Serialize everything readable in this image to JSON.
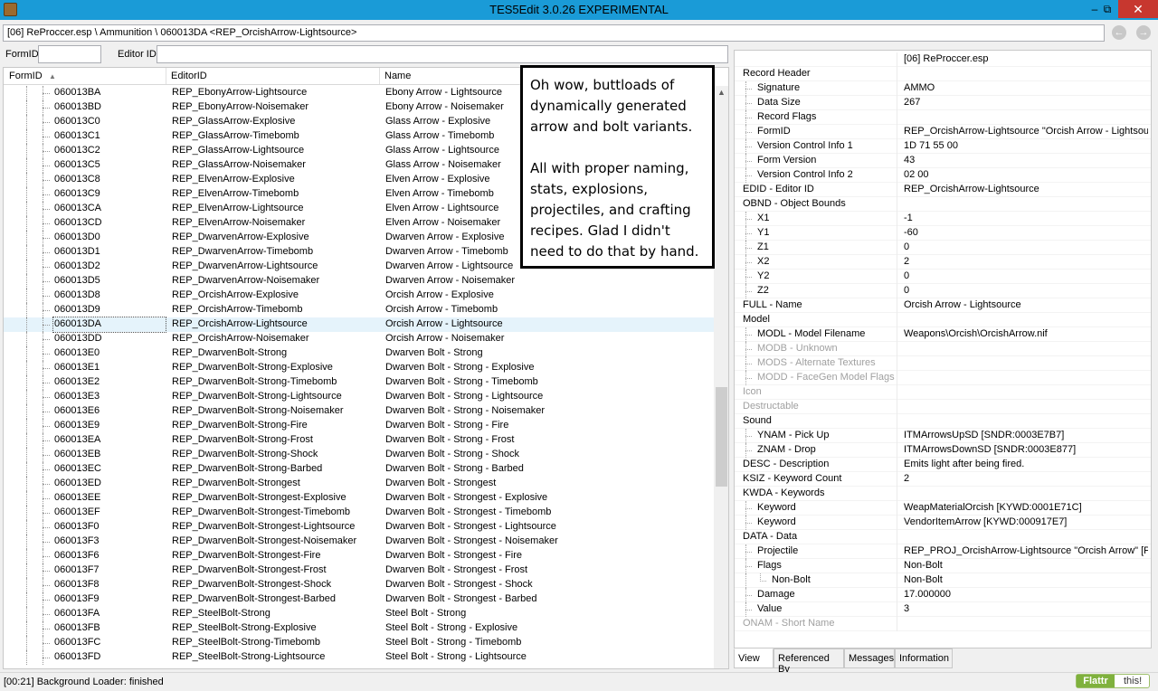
{
  "window": {
    "title": "TES5Edit 3.0.26 EXPERIMENTAL",
    "minimize": "–",
    "maximize": "⧉",
    "close": "✕"
  },
  "path": "[06] ReProccer.esp \\ Ammunition \\ 060013DA <REP_OrcishArrow-Lightsource>",
  "nav": {
    "back": "←",
    "forward": "→"
  },
  "filters": {
    "formid_label": "FormID",
    "editorid_label": "Editor ID",
    "formid_value": "",
    "editorid_value": ""
  },
  "list": {
    "headers": {
      "formid": "FormID",
      "sort_icon": "▲",
      "editorid": "EditorID",
      "name": "Name"
    },
    "selected_index": 16,
    "rows": [
      {
        "formid": "060013BA",
        "edid": "REP_EbonyArrow-Lightsource",
        "name": "Ebony Arrow - Lightsource"
      },
      {
        "formid": "060013BD",
        "edid": "REP_EbonyArrow-Noisemaker",
        "name": "Ebony Arrow - Noisemaker"
      },
      {
        "formid": "060013C0",
        "edid": "REP_GlassArrow-Explosive",
        "name": "Glass Arrow - Explosive"
      },
      {
        "formid": "060013C1",
        "edid": "REP_GlassArrow-Timebomb",
        "name": "Glass Arrow - Timebomb"
      },
      {
        "formid": "060013C2",
        "edid": "REP_GlassArrow-Lightsource",
        "name": "Glass Arrow - Lightsource"
      },
      {
        "formid": "060013C5",
        "edid": "REP_GlassArrow-Noisemaker",
        "name": "Glass Arrow - Noisemaker"
      },
      {
        "formid": "060013C8",
        "edid": "REP_ElvenArrow-Explosive",
        "name": "Elven Arrow - Explosive"
      },
      {
        "formid": "060013C9",
        "edid": "REP_ElvenArrow-Timebomb",
        "name": "Elven Arrow - Timebomb"
      },
      {
        "formid": "060013CA",
        "edid": "REP_ElvenArrow-Lightsource",
        "name": "Elven Arrow - Lightsource"
      },
      {
        "formid": "060013CD",
        "edid": "REP_ElvenArrow-Noisemaker",
        "name": "Elven Arrow - Noisemaker"
      },
      {
        "formid": "060013D0",
        "edid": "REP_DwarvenArrow-Explosive",
        "name": "Dwarven Arrow - Explosive"
      },
      {
        "formid": "060013D1",
        "edid": "REP_DwarvenArrow-Timebomb",
        "name": "Dwarven Arrow - Timebomb"
      },
      {
        "formid": "060013D2",
        "edid": "REP_DwarvenArrow-Lightsource",
        "name": "Dwarven Arrow - Lightsource"
      },
      {
        "formid": "060013D5",
        "edid": "REP_DwarvenArrow-Noisemaker",
        "name": "Dwarven Arrow - Noisemaker"
      },
      {
        "formid": "060013D8",
        "edid": "REP_OrcishArrow-Explosive",
        "name": "Orcish Arrow - Explosive"
      },
      {
        "formid": "060013D9",
        "edid": "REP_OrcishArrow-Timebomb",
        "name": "Orcish Arrow - Timebomb"
      },
      {
        "formid": "060013DA",
        "edid": "REP_OrcishArrow-Lightsource",
        "name": "Orcish Arrow - Lightsource"
      },
      {
        "formid": "060013DD",
        "edid": "REP_OrcishArrow-Noisemaker",
        "name": "Orcish Arrow - Noisemaker"
      },
      {
        "formid": "060013E0",
        "edid": "REP_DwarvenBolt-Strong",
        "name": "Dwarven Bolt - Strong"
      },
      {
        "formid": "060013E1",
        "edid": "REP_DwarvenBolt-Strong-Explosive",
        "name": "Dwarven Bolt - Strong - Explosive"
      },
      {
        "formid": "060013E2",
        "edid": "REP_DwarvenBolt-Strong-Timebomb",
        "name": "Dwarven Bolt - Strong - Timebomb"
      },
      {
        "formid": "060013E3",
        "edid": "REP_DwarvenBolt-Strong-Lightsource",
        "name": "Dwarven Bolt - Strong - Lightsource"
      },
      {
        "formid": "060013E6",
        "edid": "REP_DwarvenBolt-Strong-Noisemaker",
        "name": "Dwarven Bolt - Strong - Noisemaker"
      },
      {
        "formid": "060013E9",
        "edid": "REP_DwarvenBolt-Strong-Fire",
        "name": "Dwarven Bolt - Strong - Fire"
      },
      {
        "formid": "060013EA",
        "edid": "REP_DwarvenBolt-Strong-Frost",
        "name": "Dwarven Bolt - Strong - Frost"
      },
      {
        "formid": "060013EB",
        "edid": "REP_DwarvenBolt-Strong-Shock",
        "name": "Dwarven Bolt - Strong - Shock"
      },
      {
        "formid": "060013EC",
        "edid": "REP_DwarvenBolt-Strong-Barbed",
        "name": "Dwarven Bolt - Strong - Barbed"
      },
      {
        "formid": "060013ED",
        "edid": "REP_DwarvenBolt-Strongest",
        "name": "Dwarven Bolt - Strongest"
      },
      {
        "formid": "060013EE",
        "edid": "REP_DwarvenBolt-Strongest-Explosive",
        "name": "Dwarven Bolt - Strongest - Explosive"
      },
      {
        "formid": "060013EF",
        "edid": "REP_DwarvenBolt-Strongest-Timebomb",
        "name": "Dwarven Bolt - Strongest - Timebomb"
      },
      {
        "formid": "060013F0",
        "edid": "REP_DwarvenBolt-Strongest-Lightsource",
        "name": "Dwarven Bolt - Strongest - Lightsource"
      },
      {
        "formid": "060013F3",
        "edid": "REP_DwarvenBolt-Strongest-Noisemaker",
        "name": "Dwarven Bolt - Strongest - Noisemaker"
      },
      {
        "formid": "060013F6",
        "edid": "REP_DwarvenBolt-Strongest-Fire",
        "name": "Dwarven Bolt - Strongest - Fire"
      },
      {
        "formid": "060013F7",
        "edid": "REP_DwarvenBolt-Strongest-Frost",
        "name": "Dwarven Bolt - Strongest - Frost"
      },
      {
        "formid": "060013F8",
        "edid": "REP_DwarvenBolt-Strongest-Shock",
        "name": "Dwarven Bolt - Strongest - Shock"
      },
      {
        "formid": "060013F9",
        "edid": "REP_DwarvenBolt-Strongest-Barbed",
        "name": "Dwarven Bolt - Strongest - Barbed"
      },
      {
        "formid": "060013FA",
        "edid": "REP_SteelBolt-Strong",
        "name": "Steel Bolt - Strong"
      },
      {
        "formid": "060013FB",
        "edid": "REP_SteelBolt-Strong-Explosive",
        "name": "Steel Bolt - Strong - Explosive"
      },
      {
        "formid": "060013FC",
        "edid": "REP_SteelBolt-Strong-Timebomb",
        "name": "Steel Bolt - Strong - Timebomb"
      },
      {
        "formid": "060013FD",
        "edid": "REP_SteelBolt-Strong-Lightsource",
        "name": "Steel Bolt - Strong - Lightsource"
      }
    ]
  },
  "note": {
    "p1": "Oh wow, buttloads of dynamically generated arrow and bolt variants.",
    "p2": "All with proper naming, stats, explosions, projectiles, and crafting recipes. Glad I didn't need to do that by hand."
  },
  "record": {
    "header_value": "[06] ReProccer.esp",
    "rows": [
      {
        "label": "Record Header",
        "value": "",
        "level": 0,
        "gray": false
      },
      {
        "label": "Signature",
        "value": "AMMO",
        "level": 1,
        "gray": false
      },
      {
        "label": "Data Size",
        "value": "267",
        "level": 1,
        "gray": false
      },
      {
        "label": "Record Flags",
        "value": "",
        "level": 1,
        "gray": false
      },
      {
        "label": "FormID",
        "value": "REP_OrcishArrow-Lightsource \"Orcish Arrow - Lightsou...",
        "level": 1,
        "gray": false
      },
      {
        "label": "Version Control Info 1",
        "value": "1D 71 55 00",
        "level": 1,
        "gray": false
      },
      {
        "label": "Form Version",
        "value": "43",
        "level": 1,
        "gray": false
      },
      {
        "label": "Version Control Info 2",
        "value": "02 00",
        "level": 1,
        "gray": false
      },
      {
        "label": "EDID - Editor ID",
        "value": "REP_OrcishArrow-Lightsource",
        "level": 0,
        "gray": false
      },
      {
        "label": "OBND - Object Bounds",
        "value": "",
        "level": 0,
        "gray": false
      },
      {
        "label": "X1",
        "value": "-1",
        "level": 1,
        "gray": false
      },
      {
        "label": "Y1",
        "value": "-60",
        "level": 1,
        "gray": false
      },
      {
        "label": "Z1",
        "value": "0",
        "level": 1,
        "gray": false
      },
      {
        "label": "X2",
        "value": "2",
        "level": 1,
        "gray": false
      },
      {
        "label": "Y2",
        "value": "0",
        "level": 1,
        "gray": false
      },
      {
        "label": "Z2",
        "value": "0",
        "level": 1,
        "gray": false
      },
      {
        "label": "FULL - Name",
        "value": "Orcish Arrow - Lightsource",
        "level": 0,
        "gray": false
      },
      {
        "label": "Model",
        "value": "",
        "level": 0,
        "gray": false
      },
      {
        "label": "MODL - Model Filename",
        "value": "Weapons\\Orcish\\OrcishArrow.nif",
        "level": 1,
        "gray": false
      },
      {
        "label": "MODB - Unknown",
        "value": "",
        "level": 1,
        "gray": true
      },
      {
        "label": "MODS - Alternate Textures",
        "value": "",
        "level": 1,
        "gray": true
      },
      {
        "label": "MODD - FaceGen Model Flags",
        "value": "",
        "level": 1,
        "gray": true
      },
      {
        "label": "Icon",
        "value": "",
        "level": 0,
        "gray": true
      },
      {
        "label": "Destructable",
        "value": "",
        "level": 0,
        "gray": true
      },
      {
        "label": "Sound",
        "value": "",
        "level": 0,
        "gray": false
      },
      {
        "label": "YNAM - Pick Up",
        "value": "ITMArrowsUpSD [SNDR:0003E7B7]",
        "level": 1,
        "gray": false
      },
      {
        "label": "ZNAM - Drop",
        "value": "ITMArrowsDownSD [SNDR:0003E877]",
        "level": 1,
        "gray": false
      },
      {
        "label": "DESC - Description",
        "value": "Emits light after being fired.",
        "level": 0,
        "gray": false
      },
      {
        "label": "KSIZ - Keyword Count",
        "value": "2",
        "level": 0,
        "gray": false
      },
      {
        "label": "KWDA - Keywords",
        "value": "",
        "level": 0,
        "gray": false
      },
      {
        "label": "Keyword",
        "value": "WeapMaterialOrcish [KYWD:0001E71C]",
        "level": 1,
        "gray": false
      },
      {
        "label": "Keyword",
        "value": "VendorItemArrow [KYWD:000917E7]",
        "level": 1,
        "gray": false
      },
      {
        "label": "DATA - Data",
        "value": "",
        "level": 0,
        "gray": false
      },
      {
        "label": "Projectile",
        "value": "REP_PROJ_OrcishArrow-Lightsource \"Orcish Arrow\" [PR...",
        "level": 1,
        "gray": false
      },
      {
        "label": "Flags",
        "value": "Non-Bolt",
        "level": 1,
        "gray": false
      },
      {
        "label": "Non-Bolt",
        "value": "Non-Bolt",
        "level": 2,
        "gray": false
      },
      {
        "label": "Damage",
        "value": "17.000000",
        "level": 1,
        "gray": false
      },
      {
        "label": "Value",
        "value": "3",
        "level": 1,
        "gray": false
      },
      {
        "label": "ONAM - Short Name",
        "value": "",
        "level": 0,
        "gray": true
      }
    ]
  },
  "tabs": [
    "View",
    "Referenced By",
    "Messages",
    "Information"
  ],
  "status": {
    "text": "[00:21] Background Loader: finished",
    "flattr_left": "Flattr",
    "flattr_right": "this!"
  }
}
